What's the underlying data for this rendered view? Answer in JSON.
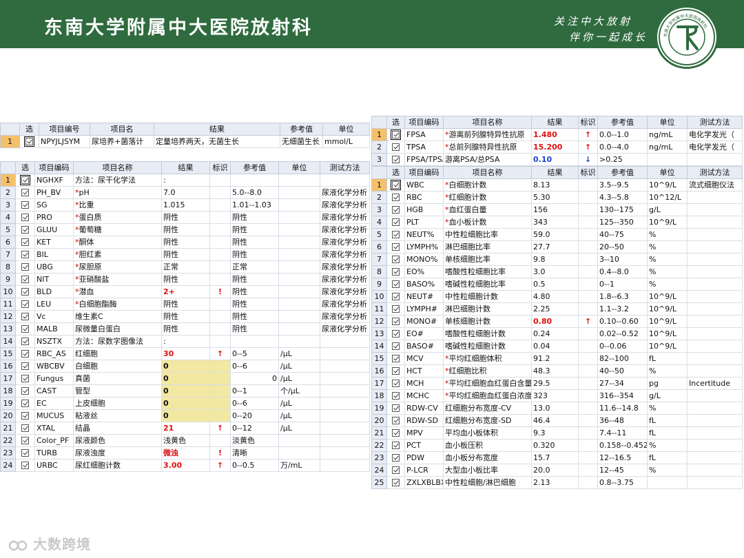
{
  "banner": {
    "title": "东南大学附属中大医院放射科",
    "slogan_line1": "关注中大放射",
    "slogan_line2": "伴你一起成长",
    "bg_color": "#2f6b3e",
    "logo_text": "东南大学附属中大医院放射科"
  },
  "watermark": {
    "text": "大数跨境"
  },
  "culture_table": {
    "headers": [
      "选",
      "项目编号",
      "项目名",
      "结果",
      "参考值",
      "单位"
    ],
    "rows": [
      {
        "no": "1",
        "code": "NPYJLJSYM",
        "name": "尿培养+菌落计",
        "result": "定量培养两天，无菌生长",
        "ref": "无细菌生长",
        "unit": "mmol/L"
      }
    ]
  },
  "urine_table": {
    "headers": [
      "选",
      "项目编码",
      "项目名称",
      "结果",
      "标识",
      "参考值",
      "单位",
      "测试方法"
    ],
    "rows": [
      {
        "no": "1",
        "code": "NGHXF",
        "star": "",
        "name": "方法：尿干化学法",
        "result": ":",
        "flag": "",
        "ref": "",
        "unit": "",
        "method": ""
      },
      {
        "no": "2",
        "code": "PH_BV",
        "star": "*",
        "name": "pH",
        "result": "7.0",
        "flag": "",
        "ref": "5.0--8.0",
        "unit": "",
        "method": "尿液化学分析"
      },
      {
        "no": "3",
        "code": "SG",
        "star": "*",
        "name": "比重",
        "result": "1.015",
        "flag": "",
        "ref": "1.01--1.03",
        "unit": "",
        "method": "尿液化学分析"
      },
      {
        "no": "4",
        "code": "PRO",
        "star": "*",
        "name": "蛋白质",
        "result": "阴性",
        "flag": "",
        "ref": "阴性",
        "unit": "",
        "method": "尿液化学分析"
      },
      {
        "no": "5",
        "code": "GLUU",
        "star": "*",
        "name": "葡萄糖",
        "result": "阴性",
        "flag": "",
        "ref": "阴性",
        "unit": "",
        "method": "尿液化学分析"
      },
      {
        "no": "6",
        "code": "KET",
        "star": "*",
        "name": "酮体",
        "result": "阴性",
        "flag": "",
        "ref": "阴性",
        "unit": "",
        "method": "尿液化学分析"
      },
      {
        "no": "7",
        "code": "BIL",
        "star": "*",
        "name": "胆红素",
        "result": "阴性",
        "flag": "",
        "ref": "阴性",
        "unit": "",
        "method": "尿液化学分析"
      },
      {
        "no": "8",
        "code": "UBG",
        "star": "*",
        "name": "尿胆原",
        "result": "正常",
        "flag": "",
        "ref": "正常",
        "unit": "",
        "method": "尿液化学分析"
      },
      {
        "no": "9",
        "code": "NIT",
        "star": "*",
        "name": "亚硝酸盐",
        "result": "阴性",
        "flag": "",
        "ref": "阴性",
        "unit": "",
        "method": "尿液化学分析"
      },
      {
        "no": "10",
        "code": "BLD",
        "star": "*",
        "name": "潜血",
        "result": "2+",
        "flag": "!",
        "ref": "阴性",
        "unit": "",
        "method": "尿液化学分析",
        "abnormal": true
      },
      {
        "no": "11",
        "code": "LEU",
        "star": "*",
        "name": "白细胞酯酶",
        "result": "阴性",
        "flag": "",
        "ref": "阴性",
        "unit": "",
        "method": "尿液化学分析"
      },
      {
        "no": "12",
        "code": "Vc",
        "star": "",
        "name": "维生素C",
        "result": "阴性",
        "flag": "",
        "ref": "阴性",
        "unit": "",
        "method": "尿液化学分析"
      },
      {
        "no": "13",
        "code": "MALB",
        "star": "",
        "name": "尿微量白蛋白",
        "result": "阴性",
        "flag": "",
        "ref": "阴性",
        "unit": "",
        "method": "尿液化学分析"
      },
      {
        "no": "14",
        "code": "NSZTX",
        "star": "",
        "name": "方法：尿数字图像法",
        "result": ":",
        "flag": "",
        "ref": "",
        "unit": "",
        "method": ""
      },
      {
        "no": "15",
        "code": "RBC_AS",
        "star": "",
        "name": "红细胞",
        "result": "30",
        "flag": "↑",
        "ref": "0--5",
        "unit": "/μL",
        "method": "",
        "abnormal": true
      },
      {
        "no": "16",
        "code": "WBCBV",
        "star": "",
        "name": "白细胞",
        "result": "0",
        "flag": "",
        "ref": "0--6",
        "unit": "/μL",
        "method": "",
        "hl": true
      },
      {
        "no": "17",
        "code": "Fungus",
        "star": "",
        "name": "真菌",
        "result": "0",
        "flag": "",
        "ref": "0",
        "unit": "/μL",
        "method": "",
        "hl": true,
        "ref_right": true
      },
      {
        "no": "18",
        "code": "CAST",
        "star": "",
        "name": "管型",
        "result": "0",
        "flag": "",
        "ref": "0--1",
        "unit": "个/μL",
        "method": "",
        "hl": true
      },
      {
        "no": "19",
        "code": "EC",
        "star": "",
        "name": "上皮细胞",
        "result": "0",
        "flag": "",
        "ref": "0--6",
        "unit": "/μL",
        "method": "",
        "hl": true
      },
      {
        "no": "20",
        "code": "MUCUS",
        "star": "",
        "name": "粘液丝",
        "result": "0",
        "flag": "",
        "ref": "0--20",
        "unit": "/μL",
        "method": "",
        "hl": true
      },
      {
        "no": "21",
        "code": "XTAL",
        "star": "",
        "name": "结晶",
        "result": "21",
        "flag": "↑",
        "ref": "0--12",
        "unit": "/μL",
        "method": "",
        "abnormal": true
      },
      {
        "no": "22",
        "code": "Color_PF",
        "star": "",
        "name": "尿液颜色",
        "result": "浅黄色",
        "flag": "",
        "ref": "淡黄色",
        "unit": "",
        "method": ""
      },
      {
        "no": "23",
        "code": "TURB",
        "star": "",
        "name": "尿液浊度",
        "result": "微浊",
        "flag": "!",
        "ref": "清晰",
        "unit": "",
        "method": "",
        "abnormal": true
      },
      {
        "no": "24",
        "code": "URBC",
        "star": "",
        "name": "尿红细胞计数",
        "result": "3.00",
        "flag": "↑",
        "ref": "0--0.5",
        "unit": "万/mL",
        "method": "",
        "abnormal": true
      }
    ]
  },
  "psa_table": {
    "headers": [
      "选",
      "项目编码",
      "项目名称",
      "结果",
      "标识",
      "参考值",
      "单位",
      "测试方法"
    ],
    "rows": [
      {
        "no": "1",
        "code": "FPSA",
        "star": "*",
        "name": "游离前列腺特异性抗原",
        "result": "1.480",
        "flag": "↑",
        "ref": "0.0--1.0",
        "unit": "ng/mL",
        "method": "电化学发光（",
        "tone": "red"
      },
      {
        "no": "2",
        "code": "TPSA",
        "star": "*",
        "name": "总前列腺特异性抗原",
        "result": "15.200",
        "flag": "↑",
        "ref": "0.0--4.0",
        "unit": "ng/mL",
        "method": "电化学发光（",
        "tone": "red"
      },
      {
        "no": "3",
        "code": "FPSA/TPSA",
        "star": "",
        "name": "游离PSA/总PSA",
        "result": "0.10",
        "flag": "↓",
        "ref": ">0.25",
        "unit": "",
        "method": "",
        "tone": "blue"
      }
    ]
  },
  "blood_table": {
    "headers": [
      "选",
      "项目编码",
      "项目名称",
      "结果",
      "标识",
      "参考值",
      "单位",
      "测试方法"
    ],
    "rows": [
      {
        "no": "1",
        "code": "WBC",
        "star": "*",
        "name": "白细胞计数",
        "result": "8.13",
        "flag": "",
        "ref": "3.5--9.5",
        "unit": "10^9/L",
        "method": "流式细胞仪法"
      },
      {
        "no": "2",
        "code": "RBC",
        "star": "*",
        "name": "红细胞计数",
        "result": "5.30",
        "flag": "",
        "ref": "4.3--5.8",
        "unit": "10^12/L",
        "method": ""
      },
      {
        "no": "3",
        "code": "HGB",
        "star": "*",
        "name": "血红蛋白量",
        "result": "156",
        "flag": "",
        "ref": "130--175",
        "unit": "g/L",
        "method": ""
      },
      {
        "no": "4",
        "code": "PLT",
        "star": "*",
        "name": "血小板计数",
        "result": "343",
        "flag": "",
        "ref": "125--350",
        "unit": "10^9/L",
        "method": ""
      },
      {
        "no": "5",
        "code": "NEUT%",
        "star": "",
        "name": "中性粒细胞比率",
        "result": "59.0",
        "flag": "",
        "ref": "40--75",
        "unit": "%",
        "method": ""
      },
      {
        "no": "6",
        "code": "LYMPH%",
        "star": "",
        "name": "淋巴细胞比率",
        "result": "27.7",
        "flag": "",
        "ref": "20--50",
        "unit": "%",
        "method": ""
      },
      {
        "no": "7",
        "code": "MONO%",
        "star": "",
        "name": "单核细胞比率",
        "result": "9.8",
        "flag": "",
        "ref": "3--10",
        "unit": "%",
        "method": ""
      },
      {
        "no": "8",
        "code": "EO%",
        "star": "",
        "name": "嗜酸性粒细胞比率",
        "result": "3.0",
        "flag": "",
        "ref": "0.4--8.0",
        "unit": "%",
        "method": ""
      },
      {
        "no": "9",
        "code": "BASO%",
        "star": "",
        "name": "嗜碱性粒细胞比率",
        "result": "0.5",
        "flag": "",
        "ref": "0--1",
        "unit": "%",
        "method": ""
      },
      {
        "no": "10",
        "code": "NEUT#",
        "star": "",
        "name": "中性粒细胞计数",
        "result": "4.80",
        "flag": "",
        "ref": "1.8--6.3",
        "unit": "10^9/L",
        "method": ""
      },
      {
        "no": "11",
        "code": "LYMPH#",
        "star": "",
        "name": "淋巴细胞计数",
        "result": "2.25",
        "flag": "",
        "ref": "1.1--3.2",
        "unit": "10^9/L",
        "method": ""
      },
      {
        "no": "12",
        "code": "MONO#",
        "star": "",
        "name": "单核细胞计数",
        "result": "0.80",
        "flag": "↑",
        "ref": "0.10--0.60",
        "unit": "10^9/L",
        "method": "",
        "tone": "red"
      },
      {
        "no": "13",
        "code": "EO#",
        "star": "",
        "name": "嗜酸性粒细胞计数",
        "result": "0.24",
        "flag": "",
        "ref": "0.02--0.52",
        "unit": "10^9/L",
        "method": ""
      },
      {
        "no": "14",
        "code": "BASO#",
        "star": "",
        "name": "嗜碱性粒细胞计数",
        "result": "0.04",
        "flag": "",
        "ref": "0--0.06",
        "unit": "10^9/L",
        "method": ""
      },
      {
        "no": "15",
        "code": "MCV",
        "star": "*",
        "name": "平均红细胞体积",
        "result": "91.2",
        "flag": "",
        "ref": "82--100",
        "unit": "fL",
        "method": ""
      },
      {
        "no": "16",
        "code": "HCT",
        "star": "*",
        "name": "红细胞比积",
        "result": "48.3",
        "flag": "",
        "ref": "40--50",
        "unit": "%",
        "method": ""
      },
      {
        "no": "17",
        "code": "MCH",
        "star": "*",
        "name": "平均红细胞血红蛋白含量",
        "result": "29.5",
        "flag": "",
        "ref": "27--34",
        "unit": "pg",
        "method": "Incertitude"
      },
      {
        "no": "18",
        "code": "MCHC",
        "star": "*",
        "name": "平均红细胞血红蛋白浓度",
        "result": "323",
        "flag": "",
        "ref": "316--354",
        "unit": "g/L",
        "method": ""
      },
      {
        "no": "19",
        "code": "RDW-CV",
        "star": "",
        "name": "红细胞分布宽度-CV",
        "result": "13.0",
        "flag": "",
        "ref": "11.6--14.8",
        "unit": "%",
        "method": ""
      },
      {
        "no": "20",
        "code": "RDW-SD",
        "star": "",
        "name": "红细胞分布宽度-SD",
        "result": "46.4",
        "flag": "",
        "ref": "36--48",
        "unit": "fL",
        "method": ""
      },
      {
        "no": "21",
        "code": "MPV",
        "star": "",
        "name": "平均血小板体积",
        "result": "9.3",
        "flag": "",
        "ref": "7.4--11",
        "unit": "fL",
        "method": ""
      },
      {
        "no": "22",
        "code": "PCT",
        "star": "",
        "name": "血小板压积",
        "result": "0.320",
        "flag": "",
        "ref": "0.158--0.452",
        "unit": "%",
        "method": ""
      },
      {
        "no": "23",
        "code": "PDW",
        "star": "",
        "name": "血小板分布宽度",
        "result": "15.7",
        "flag": "",
        "ref": "12--16.5",
        "unit": "fL",
        "method": ""
      },
      {
        "no": "24",
        "code": "P-LCR",
        "star": "",
        "name": "大型血小板比率",
        "result": "20.0",
        "flag": "",
        "ref": "12--45",
        "unit": "%",
        "method": ""
      },
      {
        "no": "25",
        "code": "ZXLXBLBX",
        "star": "",
        "name": "中性粒细胞/淋巴细胞",
        "result": "2.13",
        "flag": "",
        "ref": "0.8--3.75",
        "unit": "",
        "method": ""
      }
    ]
  }
}
